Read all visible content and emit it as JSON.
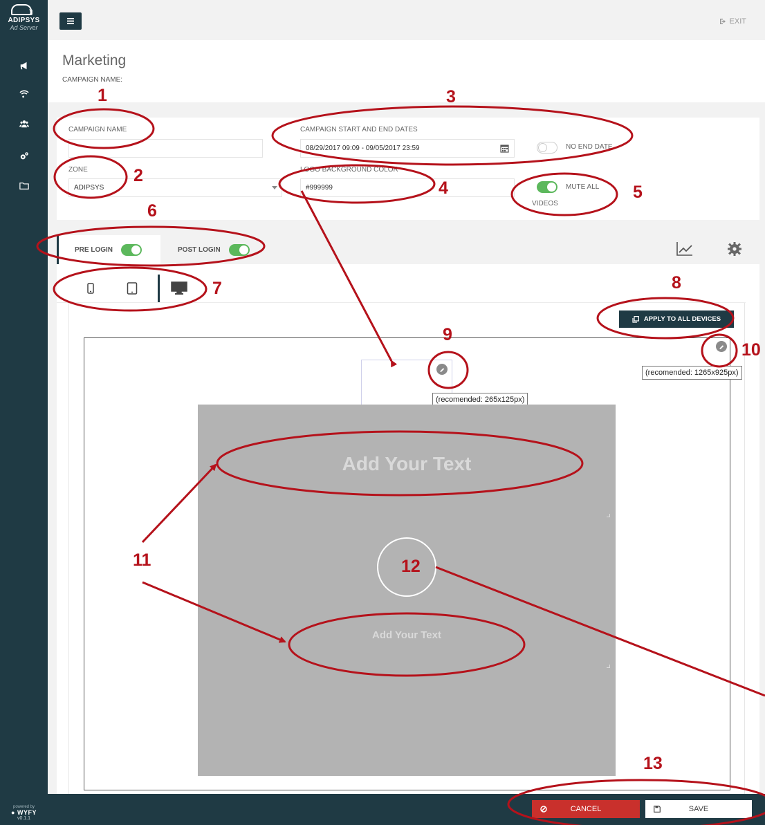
{
  "sidebar": {
    "brand_name": "ADIPSYS",
    "brand_sub": "Ad Server",
    "nav_icons": [
      "megaphone-icon",
      "wifi-icon",
      "users-icon",
      "cogs-icon",
      "folder-icon"
    ],
    "powered_by": "powered by",
    "powered_brand": "WYFY",
    "version": "v0.1.1"
  },
  "header": {
    "exit_label": "EXIT"
  },
  "page": {
    "title": "Marketing",
    "subtitle": "CAMPAIGN NAME:"
  },
  "form": {
    "campaign_name_label": "CAMPAIGN NAME",
    "campaign_name_value": "",
    "zone_label": "ZONE",
    "zone_value": "ADIPSYS",
    "dates_label": "CAMPAIGN START AND END DATES",
    "dates_value": "08/29/2017 09:09 - 09/05/2017 23:59",
    "no_end_date_label": "NO END DATE",
    "no_end_date_on": false,
    "logo_bg_label": "LOGO BACKGROUND COLOR",
    "logo_bg_value": "#999999",
    "mute_all_label": "MUTE ALL",
    "mute_all_sub": "VIDEOS",
    "mute_all_on": true
  },
  "tabs": [
    {
      "label": "PRE LOGIN",
      "on": true,
      "active": true
    },
    {
      "label": "POST LOGIN",
      "on": true,
      "active": false
    }
  ],
  "tools": [
    "chart-line-icon",
    "gear-icon"
  ],
  "devices": [
    {
      "name": "phone-icon",
      "active": false
    },
    {
      "name": "tablet-icon",
      "active": false
    },
    {
      "name": "desktop-icon",
      "active": true
    }
  ],
  "apply_button": "APPLY TO ALL DEVICES",
  "editor": {
    "logo_tooltip": "(recomended: 265x125px)",
    "background_tooltip": "(recomended: 1265x925px)",
    "title_text": "Add Your Text",
    "body_text": "Add Your Text"
  },
  "footer": {
    "cancel_label": "CANCEL",
    "save_label": "SAVE"
  },
  "annotations": [
    "1",
    "2",
    "3",
    "4",
    "5",
    "6",
    "7",
    "8",
    "9",
    "10",
    "11",
    "12",
    "13"
  ],
  "colors": {
    "sidebar": "#1f3a44",
    "toggle_on": "#5cb85c",
    "cancel": "#c9302c",
    "annotation": "#b5121b",
    "ad_background": "#b3b3b3"
  }
}
